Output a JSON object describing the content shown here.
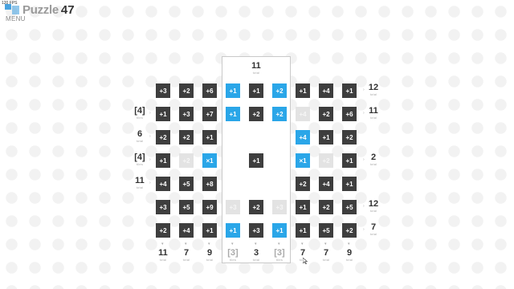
{
  "hud": {
    "fps": "120 FPS",
    "brand_word": "Puzzle",
    "level": "47",
    "menu": "MENU"
  },
  "colors": {
    "dark": "#3e3e3e",
    "blue": "#2aa6e8",
    "ghost": "#e3e3e3"
  },
  "grid": {
    "rows": [
      [
        {
          "v": "+3",
          "t": "dark"
        },
        {
          "v": "+2",
          "t": "dark"
        },
        {
          "v": "+6",
          "t": "dark"
        },
        {
          "v": "+1",
          "t": "blue"
        },
        {
          "v": "+1",
          "t": "dark"
        },
        {
          "v": "+2",
          "t": "blue"
        },
        {
          "v": "+1",
          "t": "dark"
        },
        {
          "v": "+4",
          "t": "dark"
        },
        {
          "v": "+1",
          "t": "dark"
        }
      ],
      [
        {
          "v": "+1",
          "t": "dark"
        },
        {
          "v": "+3",
          "t": "dark"
        },
        {
          "v": "+7",
          "t": "dark"
        },
        {
          "v": "+1",
          "t": "blue"
        },
        {
          "v": "+2",
          "t": "dark"
        },
        {
          "v": "+2",
          "t": "blue"
        },
        {
          "v": "+4",
          "t": "ghost"
        },
        {
          "v": "+2",
          "t": "dark"
        },
        {
          "v": "+6",
          "t": "dark"
        }
      ],
      [
        {
          "v": "+2",
          "t": "dark"
        },
        {
          "v": "+2",
          "t": "dark"
        },
        {
          "v": "+1",
          "t": "dark"
        },
        null,
        null,
        null,
        {
          "v": "+4",
          "t": "blue"
        },
        {
          "v": "+1",
          "t": "dark"
        },
        {
          "v": "+2",
          "t": "dark"
        }
      ],
      [
        {
          "v": "+1",
          "t": "dark"
        },
        {
          "v": "+2",
          "t": "ghost"
        },
        {
          "v": "×1",
          "t": "blue"
        },
        null,
        {
          "v": "+1",
          "t": "dark"
        },
        null,
        {
          "v": "×1",
          "t": "blue"
        },
        {
          "v": "+2",
          "t": "ghost"
        },
        {
          "v": "+1",
          "t": "dark"
        }
      ],
      [
        {
          "v": "+4",
          "t": "dark"
        },
        {
          "v": "+5",
          "t": "dark"
        },
        {
          "v": "+8",
          "t": "dark"
        },
        null,
        null,
        null,
        {
          "v": "+2",
          "t": "dark"
        },
        {
          "v": "+4",
          "t": "dark"
        },
        {
          "v": "+1",
          "t": "dark"
        }
      ],
      [
        {
          "v": "+3",
          "t": "dark"
        },
        {
          "v": "+5",
          "t": "dark"
        },
        {
          "v": "+9",
          "t": "dark"
        },
        {
          "v": "+3",
          "t": "ghost"
        },
        {
          "v": "+2",
          "t": "dark"
        },
        {
          "v": "+3",
          "t": "ghost"
        },
        {
          "v": "+1",
          "t": "dark"
        },
        {
          "v": "+2",
          "t": "dark"
        },
        {
          "v": "+5",
          "t": "dark"
        }
      ],
      [
        {
          "v": "+2",
          "t": "dark"
        },
        {
          "v": "+4",
          "t": "dark"
        },
        {
          "v": "+1",
          "t": "dark"
        },
        {
          "v": "+1",
          "t": "blue"
        },
        {
          "v": "+3",
          "t": "dark"
        },
        {
          "v": "+1",
          "t": "blue"
        },
        {
          "v": "+1",
          "t": "dark"
        },
        {
          "v": "+5",
          "t": "dark"
        },
        {
          "v": "+2",
          "t": "dark"
        }
      ]
    ],
    "top_clue": {
      "v": "11",
      "s": "total"
    },
    "left_clues": [
      null,
      {
        "v": "[4]",
        "s": "tiles"
      },
      {
        "v": "6",
        "s": "total"
      },
      {
        "v": "[4]",
        "s": "tiles"
      },
      {
        "v": "11",
        "s": "total"
      },
      null,
      null
    ],
    "right_clues": [
      {
        "v": "12",
        "s": "total"
      },
      {
        "v": "11",
        "s": "total"
      },
      null,
      {
        "v": "2",
        "s": "total"
      },
      null,
      {
        "v": "12",
        "s": "total"
      },
      {
        "v": "7",
        "s": "total"
      }
    ],
    "bottom_clues": [
      {
        "v": "11",
        "s": "total",
        "muted": false
      },
      {
        "v": "7",
        "s": "total",
        "muted": false
      },
      {
        "v": "9",
        "s": "total",
        "muted": false
      },
      {
        "v": "[3]",
        "s": "tiles",
        "muted": true
      },
      {
        "v": "3",
        "s": "total",
        "muted": false
      },
      {
        "v": "[3]",
        "s": "tiles",
        "muted": true
      },
      {
        "v": "7",
        "s": "total",
        "muted": false
      },
      {
        "v": "7",
        "s": "total",
        "muted": false
      },
      {
        "v": "9",
        "s": "total",
        "muted": false
      }
    ]
  }
}
